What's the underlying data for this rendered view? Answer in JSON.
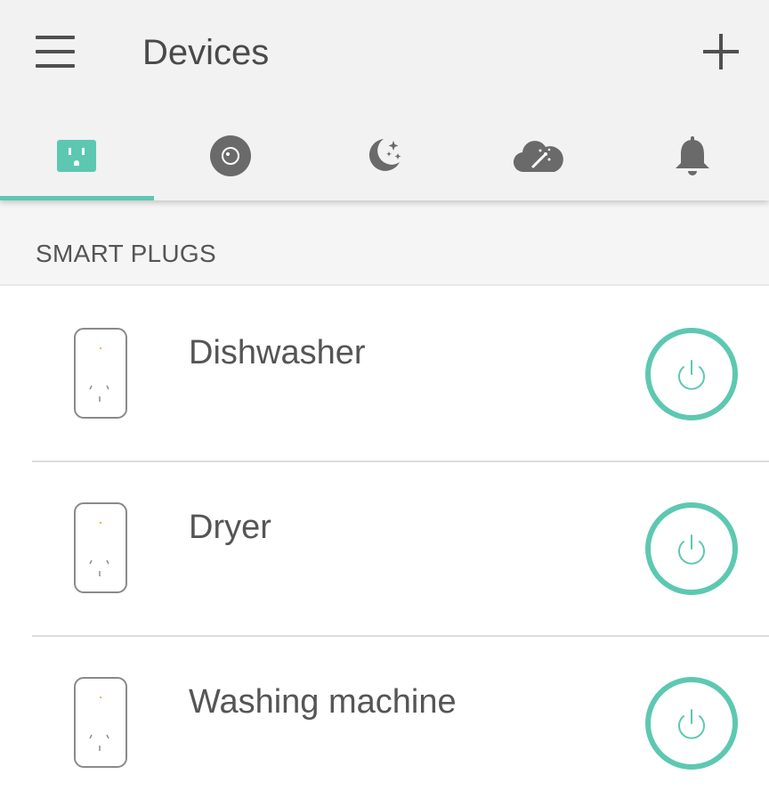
{
  "header": {
    "title": "Devices",
    "menu_icon": "hamburger-menu-icon",
    "add_icon": "plus-icon"
  },
  "tabs": [
    {
      "icon": "smart-plug-icon",
      "active": true
    },
    {
      "icon": "camera-lens-icon",
      "active": false
    },
    {
      "icon": "moon-stars-icon",
      "active": false
    },
    {
      "icon": "cloud-magic-icon",
      "active": false
    },
    {
      "icon": "bell-icon",
      "active": false
    }
  ],
  "section": {
    "title": "SMART PLUGS"
  },
  "devices": [
    {
      "name": "Dishwasher",
      "icon": "smart-plug-device-icon",
      "power_icon": "power-icon"
    },
    {
      "name": "Dryer",
      "icon": "smart-plug-device-icon",
      "power_icon": "power-icon"
    },
    {
      "name": "Washing machine",
      "icon": "smart-plug-device-icon",
      "power_icon": "power-icon"
    }
  ],
  "colors": {
    "accent": "#5dc8b2",
    "icon_gray": "#6a6a6a",
    "text": "#555555",
    "appbar_bg": "#f2f2f2"
  }
}
